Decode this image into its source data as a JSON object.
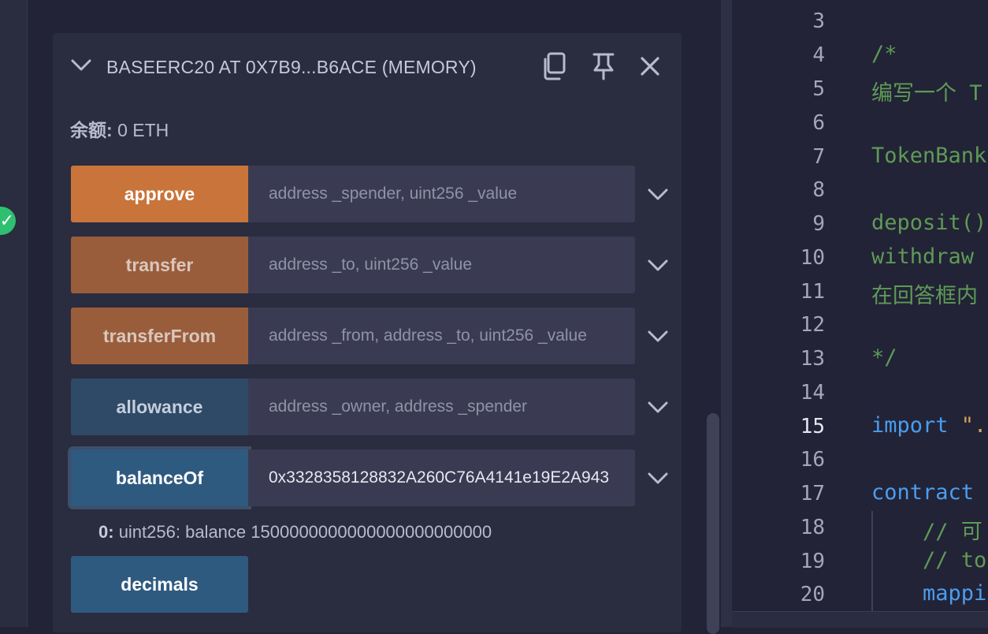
{
  "contract": {
    "title": "BASEERC20 AT 0X7B9...B6ACE (MEMORY)",
    "balance_label": "余额:",
    "balance_value": "0 ETH"
  },
  "functions": [
    {
      "name": "approve",
      "placeholder": "address _spender, uint256 _value",
      "value": "",
      "color": "#c9743a"
    },
    {
      "name": "transfer",
      "placeholder": "address _to, uint256 _value",
      "value": "",
      "color": "#9a5d3b"
    },
    {
      "name": "transferFrom",
      "placeholder": "address _from, address _to, uint256 _value",
      "value": "",
      "color": "#9a5d3b"
    },
    {
      "name": "allowance",
      "placeholder": "address _owner, address _spender",
      "value": "",
      "color": "#2f4a66"
    },
    {
      "name": "balanceOf",
      "placeholder": "",
      "value": "0x3328358128832A260C76A4141e19E2A943",
      "color": "#2f5a80"
    },
    {
      "name": "decimals",
      "color": "#2f5a80"
    }
  ],
  "output": {
    "index": "0:",
    "text": "uint256: balance 1500000000000000000000000"
  },
  "editor": {
    "lines": [
      {
        "num": "3",
        "text": ""
      },
      {
        "num": "4",
        "text": "/*"
      },
      {
        "num": "5",
        "text": "编写一个 T"
      },
      {
        "num": "6",
        "text": ""
      },
      {
        "num": "7",
        "text": "TokenBank"
      },
      {
        "num": "8",
        "text": ""
      },
      {
        "num": "9",
        "text": "deposit()"
      },
      {
        "num": "10",
        "text": "withdraw"
      },
      {
        "num": "11",
        "text": "在回答框内"
      },
      {
        "num": "12",
        "text": ""
      },
      {
        "num": "13",
        "text": "*/"
      },
      {
        "num": "14",
        "text": ""
      },
      {
        "num": "15",
        "text_kw": "import",
        "text_str": " \"."
      },
      {
        "num": "16",
        "text": ""
      },
      {
        "num": "17",
        "text_kw": "contract",
        "text": " "
      },
      {
        "num": "18",
        "text": "    // 可"
      },
      {
        "num": "19",
        "text": "    // to"
      },
      {
        "num": "20",
        "text_kw": "    mappi"
      }
    ],
    "active_line": "15"
  },
  "colors": {
    "accent_green": "#2fbf71",
    "comment": "#5f9a57",
    "keyword": "#4a9df0"
  },
  "icons": [
    "check-icon",
    "chevron-down-icon",
    "copy-icon",
    "pin-icon",
    "close-icon"
  ]
}
